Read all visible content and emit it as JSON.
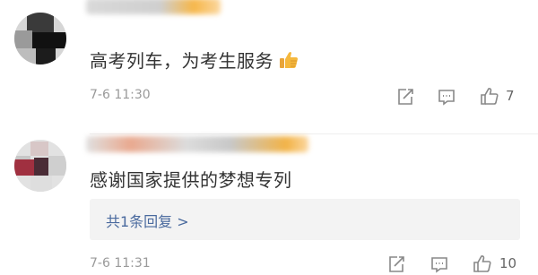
{
  "comments": [
    {
      "content": "高考列车，为考生服务",
      "time": "7-6 11:30",
      "like_count": "7",
      "icons": [
        "share-icon",
        "comment-icon",
        "thumbs-up-icon",
        "thumbs-up-emoji"
      ]
    },
    {
      "content": "感谢国家提供的梦想专列",
      "replies_label": "共1条回复 >",
      "time": "7-6 11:31",
      "like_count": "10",
      "icons": [
        "share-icon",
        "comment-icon",
        "thumbs-up-icon"
      ]
    }
  ],
  "colors": {
    "text": "#333333",
    "time": "#9a9a9a",
    "link": "#4a6a9e",
    "reply_bg": "#f3f3f3",
    "emoji": "#f5b83d"
  }
}
